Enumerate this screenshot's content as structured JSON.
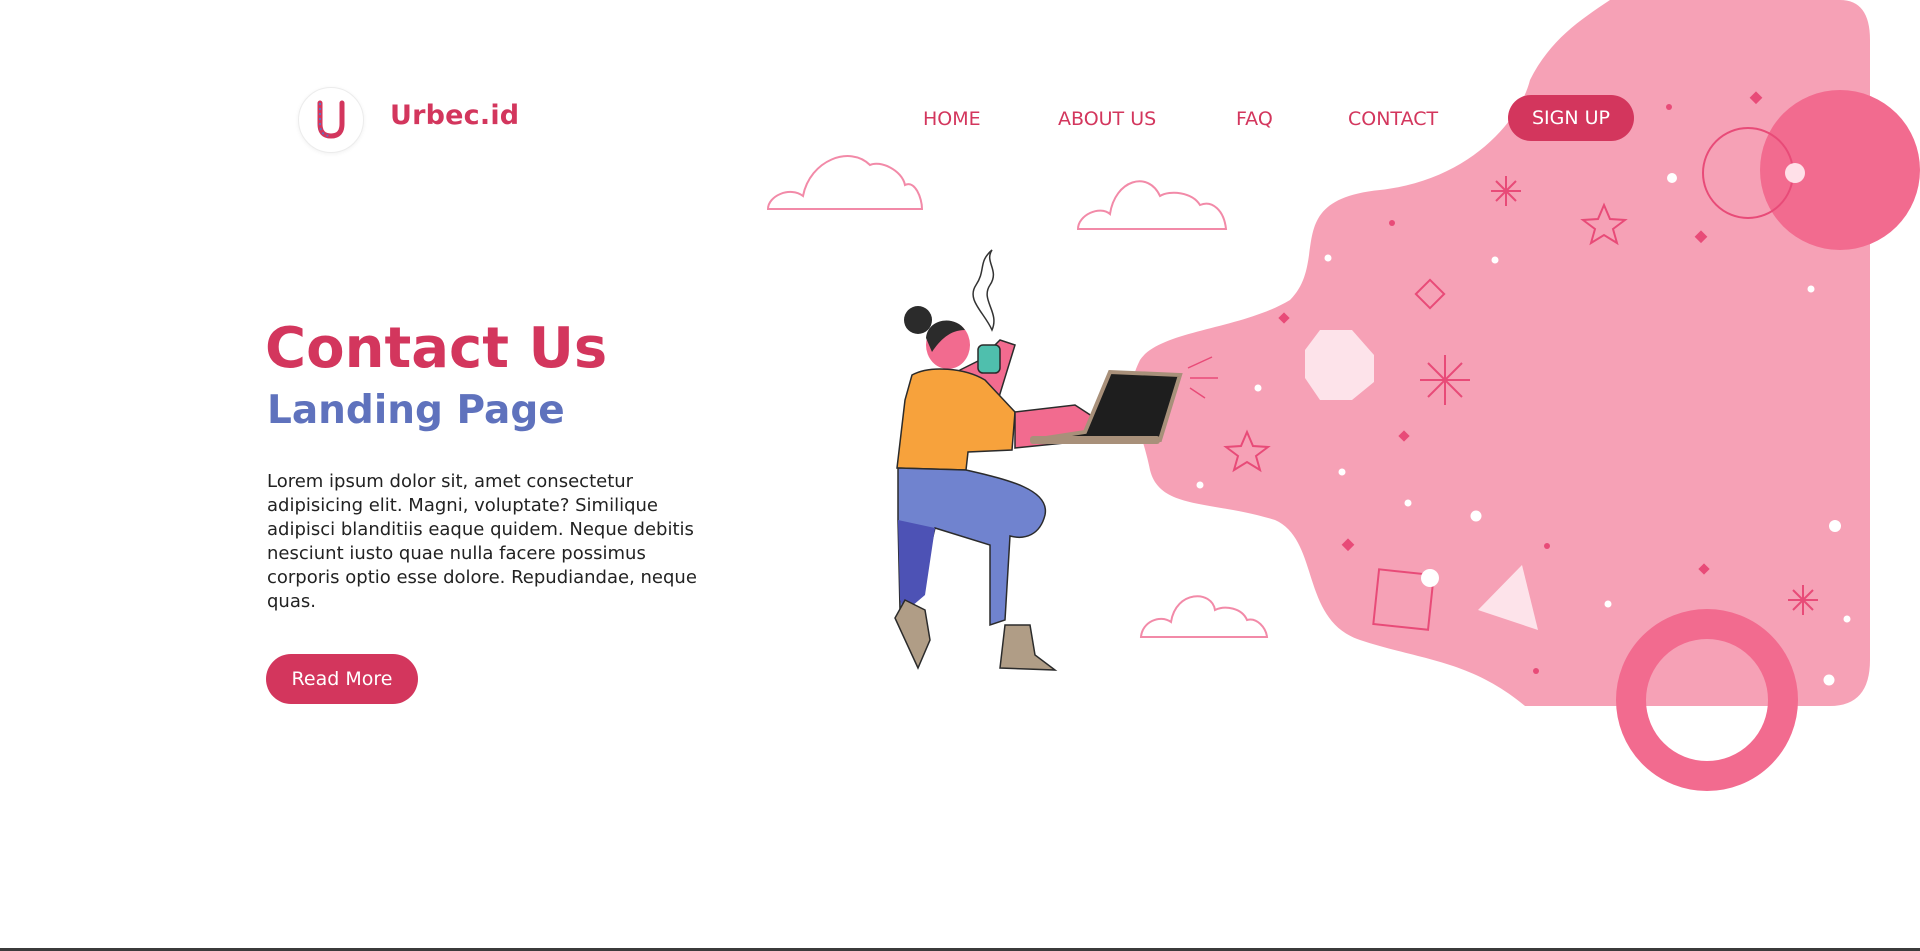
{
  "header": {
    "brand": "Urbec.id",
    "logo_icon": "u-letter-logo-icon",
    "nav": [
      {
        "label": "HOME"
      },
      {
        "label": "ABOUT US"
      },
      {
        "label": "FAQ"
      },
      {
        "label": "CONTACT"
      }
    ],
    "signup_label": "SIGN UP"
  },
  "hero": {
    "title": "Contact Us",
    "subtitle": "Landing Page",
    "body": "Lorem ipsum dolor sit, amet consectetur adipisicing elit. Magni, voluptate? Similique adipisci blanditiis eaque quidem. Neque debitis nesciunt iusto quae nulla facere possimus corporis optio esse dolore. Repudiandae, neque quas.",
    "button_label": "Read More"
  },
  "illustration": {
    "subject": "person-with-laptop-and-coffee-icon",
    "background_shape": "pink-blob",
    "decorations": [
      "cloud-icon",
      "star-icon",
      "sparkle-icon",
      "diamond-icon",
      "ring-icon",
      "triangle-icon",
      "square-icon",
      "hexagon-icon"
    ]
  },
  "colors": {
    "brand": "#d3365d",
    "subtitle": "#5f72bd",
    "blob": "#f6a1b6",
    "accent_pink": "#f26b8f",
    "shirt": "#f7a23c",
    "pants": "#7083cf"
  }
}
